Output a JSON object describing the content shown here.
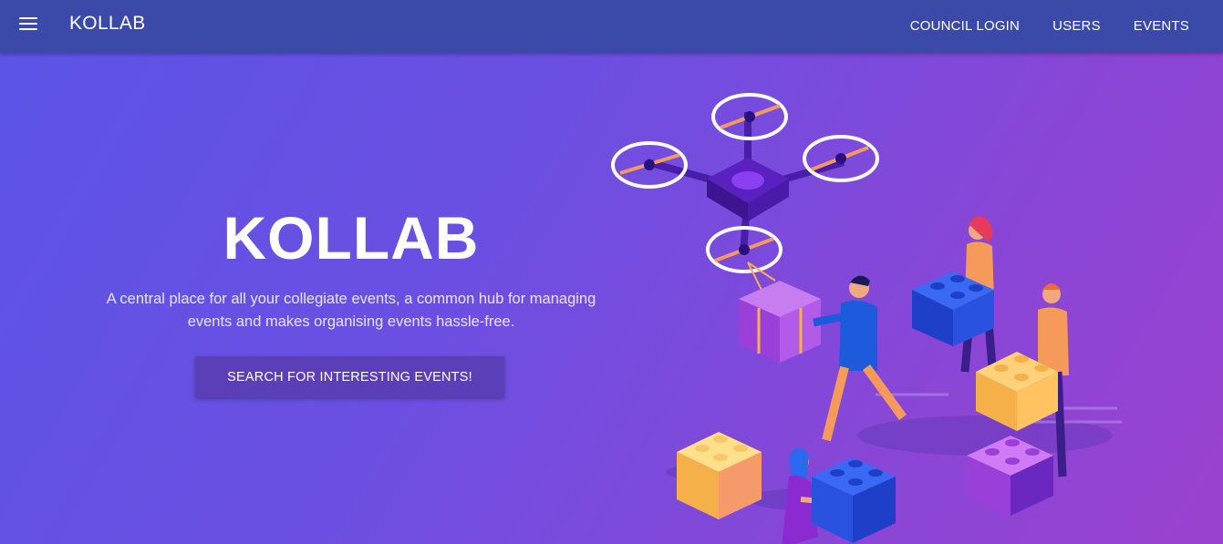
{
  "navbar": {
    "brand": "KOLLAB",
    "links": [
      "COUNCIL LOGIN",
      "USERS",
      "EVENTS"
    ]
  },
  "hero": {
    "title": "KOLLAB",
    "description": "A central place for all your collegiate events, a common hub for managing events and makes organising events hassle-free.",
    "cta_label": "SEARCH FOR INTERESTING EVENTS!"
  },
  "colors": {
    "navbar": "#3b4aa8",
    "hero_gradient_start": "#5b54e6",
    "hero_gradient_end": "#9a42d0",
    "button": "#5a3fb8"
  },
  "icons": [
    "menu-icon"
  ],
  "illustration": "drone-and-people-building-blocks"
}
